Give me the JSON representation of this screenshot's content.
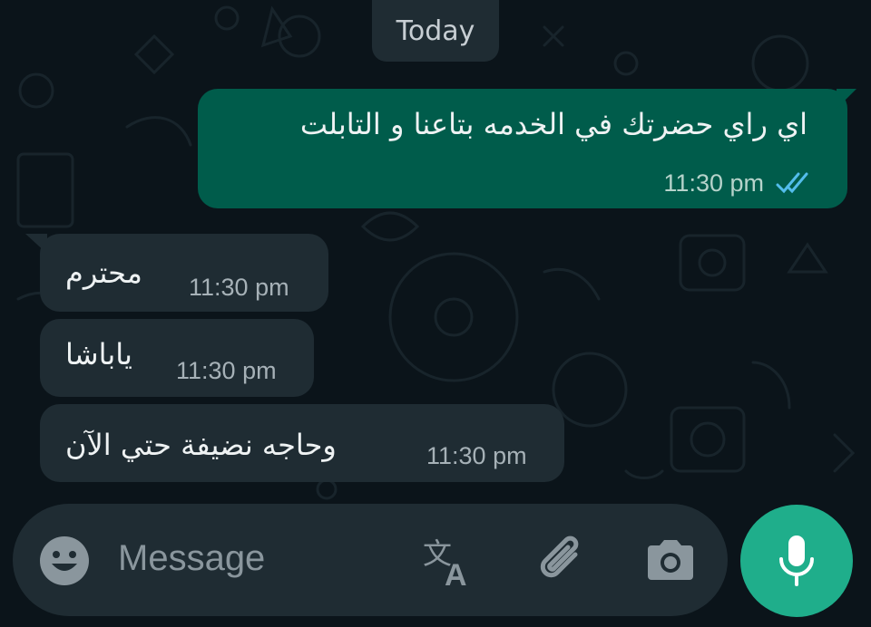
{
  "date_separator": "Today",
  "messages": [
    {
      "direction": "outgoing",
      "text": "اي راي حضرتك في الخدمه بتاعنا و التابلت",
      "time": "11:30 pm",
      "status": "read"
    },
    {
      "direction": "incoming",
      "text": "محترم",
      "time": "11:30 pm"
    },
    {
      "direction": "incoming",
      "text": "ياباشا",
      "time": "11:30 pm"
    },
    {
      "direction": "incoming",
      "text": "وحاجه نضيفة حتي الآن",
      "time": "11:30 pm"
    }
  ],
  "composer": {
    "placeholder": "Message",
    "icons": [
      "emoji-icon",
      "translate-icon",
      "attach-icon",
      "camera-icon",
      "mic-icon"
    ]
  },
  "colors": {
    "background": "#0b141a",
    "outgoing_bubble": "#005c4b",
    "incoming_bubble": "#1f2c33",
    "read_ticks": "#53bdeb",
    "accent": "#1fae8b"
  }
}
